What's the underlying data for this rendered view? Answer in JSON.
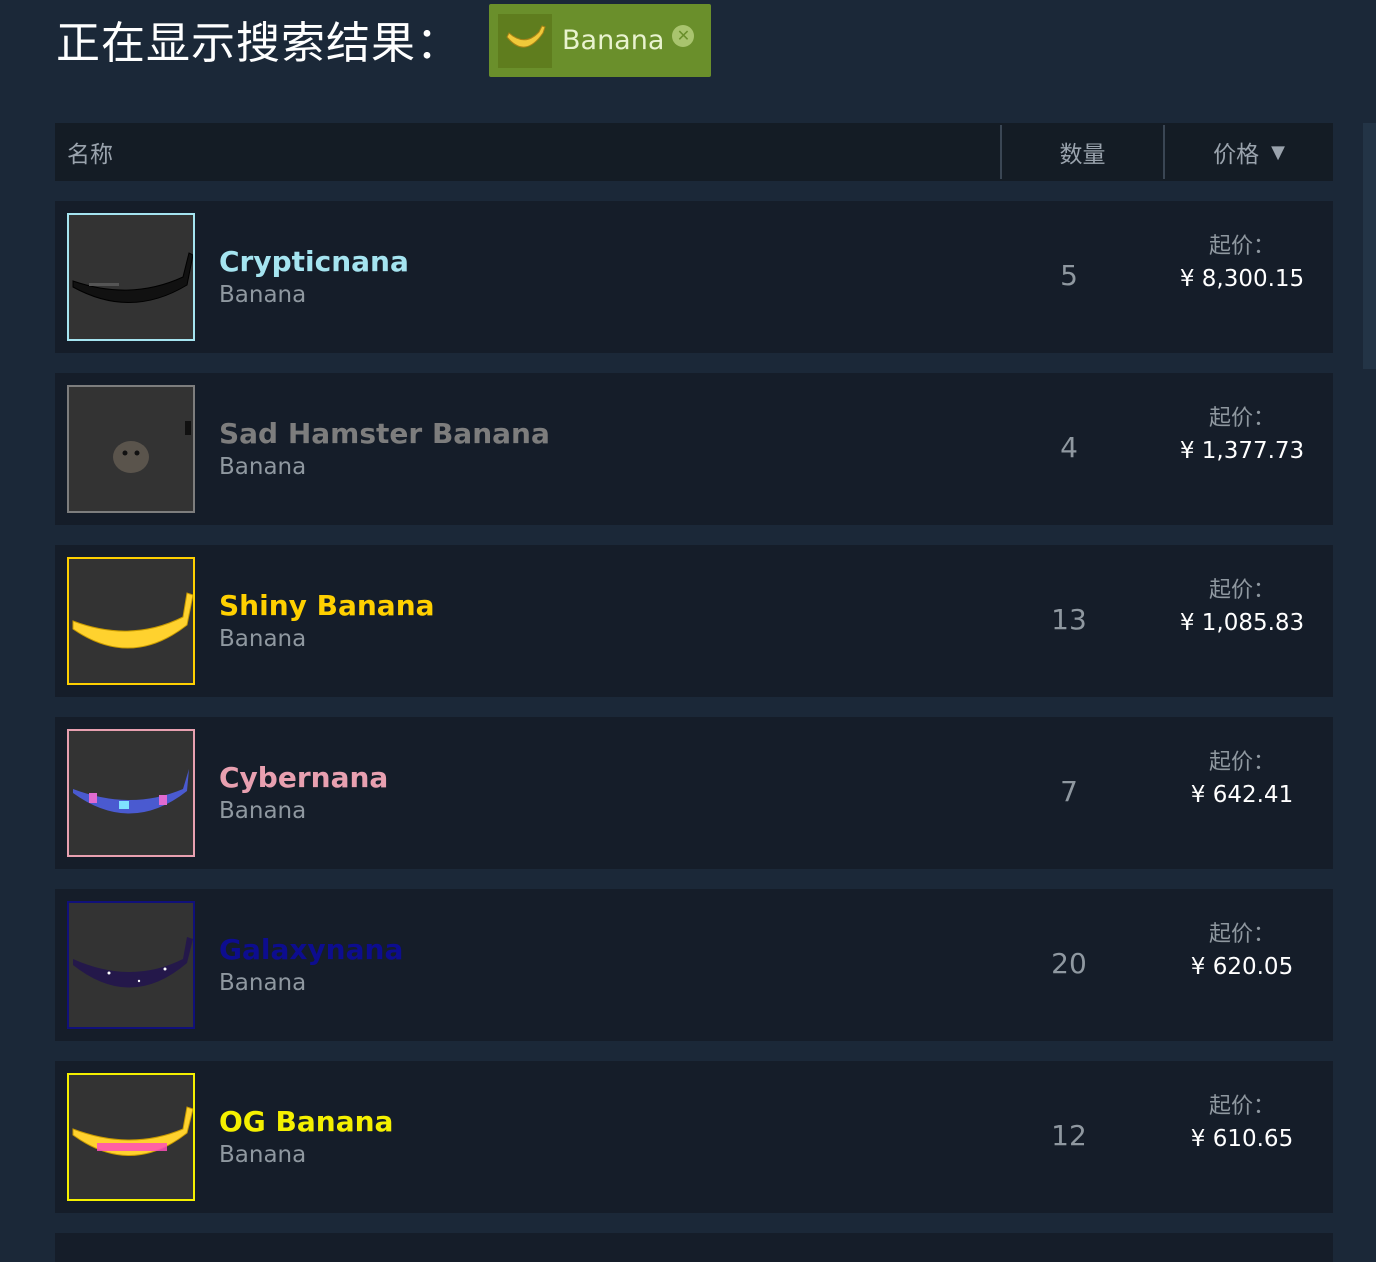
{
  "heading": "正在显示搜索结果：",
  "filter": {
    "label": "Banana",
    "remove_icon": "✕"
  },
  "columns": {
    "name": "名称",
    "quantity": "数量",
    "price": "价格",
    "sort_indicator": "▼"
  },
  "price_prefix": "起价：",
  "items": [
    {
      "name": "Crypticnana",
      "game": "Banana",
      "quantity": "5",
      "price": "¥ 8,300.15",
      "name_color": "#a5e4f0",
      "border_color": "#a5e4f0",
      "art": "cryptic"
    },
    {
      "name": "Sad Hamster Banana",
      "game": "Banana",
      "quantity": "4",
      "price": "¥ 1,377.73",
      "name_color": "#7d7d7d",
      "border_color": "#7d7d7d",
      "art": "hamster"
    },
    {
      "name": "Shiny Banana",
      "game": "Banana",
      "quantity": "13",
      "price": "¥ 1,085.83",
      "name_color": "#ffd000",
      "border_color": "#ffd000",
      "art": "shiny"
    },
    {
      "name": "Cybernana",
      "game": "Banana",
      "quantity": "7",
      "price": "¥ 642.41",
      "name_color": "#e8a0b0",
      "border_color": "#e8a0b0",
      "art": "cyber"
    },
    {
      "name": "Galaxynana",
      "game": "Banana",
      "quantity": "20",
      "price": "¥ 620.05",
      "name_color": "#0d0d8f",
      "border_color": "#10107a",
      "art": "galaxy"
    },
    {
      "name": "OG Banana",
      "game": "Banana",
      "quantity": "12",
      "price": "¥ 610.65",
      "name_color": "#f5f000",
      "border_color": "#f5f000",
      "art": "og"
    }
  ]
}
